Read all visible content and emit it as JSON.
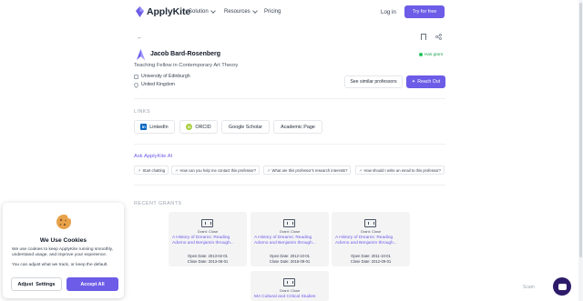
{
  "nav": {
    "logo": "ApplyKite",
    "links": [
      "Solution",
      "Resources",
      "Pricing"
    ],
    "login": "Log in",
    "try_free": "Try for free"
  },
  "profile": {
    "name": "Jacob Bard-Rosenberg",
    "badge": "Has grant",
    "title": "Teaching Fellow in Contemporary Art Theory",
    "university": "University of Edinburgh",
    "country": "United Kingdom",
    "see_similar": "See similar professors",
    "reach_out": "Reach Out"
  },
  "links": {
    "heading": "LINKS",
    "items": [
      "LinkedIn",
      "ORCID",
      "Google Scholar",
      "Academic Page"
    ]
  },
  "ask": {
    "heading": "Ask ApplyKite AI",
    "chips": [
      "Start chatting",
      "How can you help me contact this professor?",
      "What are this professor's research interests?",
      "How should I write an email to this professor?"
    ]
  },
  "grants": {
    "heading": "RECENT GRANTS",
    "items": [
      {
        "status": "Grant: Close",
        "title": "A History of Dreams: Reading Adorno and Benjamin through...",
        "open": "Open Date: 2013-02-01",
        "close": "Close Date: 2013-08-01"
      },
      {
        "status": "Grant: Close",
        "title": "A History of Dreams: Reading Adorno and Benjamin through...",
        "open": "Open Date: 2012-10-01",
        "close": "Close Date: 2016-09-01"
      },
      {
        "status": "Grant: Close",
        "title": "A History of Dreams: Reading Adorno and Benjamin through...",
        "open": "Open Date: 2011-10-01",
        "close": "Close Date: 2012-09-01"
      },
      {
        "status": "Grant: Close",
        "title": "MA Cultural and Critical Studies",
        "open": "",
        "close": ""
      }
    ]
  },
  "cookie": {
    "title": "We Use Cookies",
    "text": "We use cookies to keep ApplyKite running smoothly, understand usage, and improve your experience.",
    "sub": "You can adjust what we track, or keep the default.",
    "adjust": "Adjust  Settings",
    "accept": "Accept All"
  },
  "footer": {
    "scam": "Scam"
  },
  "colors": {
    "accent": "#6c5ce7",
    "fab": "#2d1b69",
    "success": "#16a34a"
  }
}
